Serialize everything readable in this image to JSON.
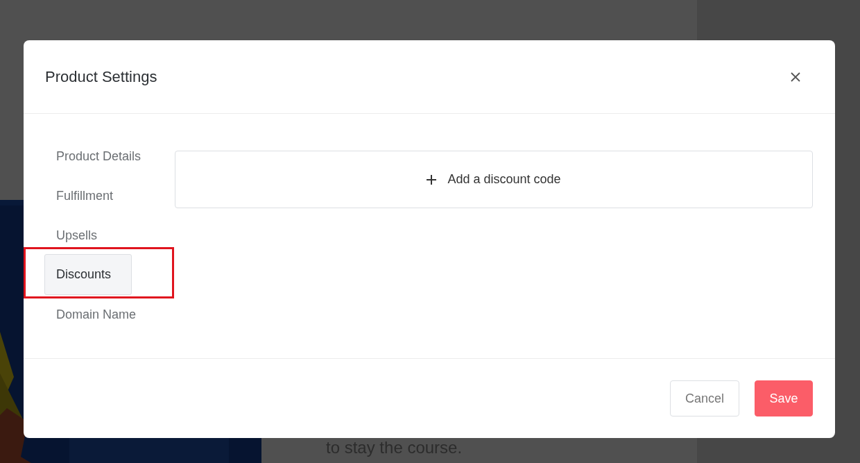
{
  "background": {
    "text": "to stay the course."
  },
  "modal": {
    "title": "Product Settings",
    "nav": [
      {
        "label": "Product Details",
        "selected": false,
        "highlighted": false
      },
      {
        "label": "Fulfillment",
        "selected": false,
        "highlighted": false
      },
      {
        "label": "Upsells",
        "selected": false,
        "highlighted": false
      },
      {
        "label": "Discounts",
        "selected": true,
        "highlighted": true
      },
      {
        "label": "Domain Name",
        "selected": false,
        "highlighted": false
      }
    ],
    "add_discount": {
      "label": "Add a discount code"
    },
    "buttons": [
      {
        "label": "Cancel",
        "kind": "secondary"
      },
      {
        "label": "Save",
        "kind": "primary"
      }
    ]
  }
}
